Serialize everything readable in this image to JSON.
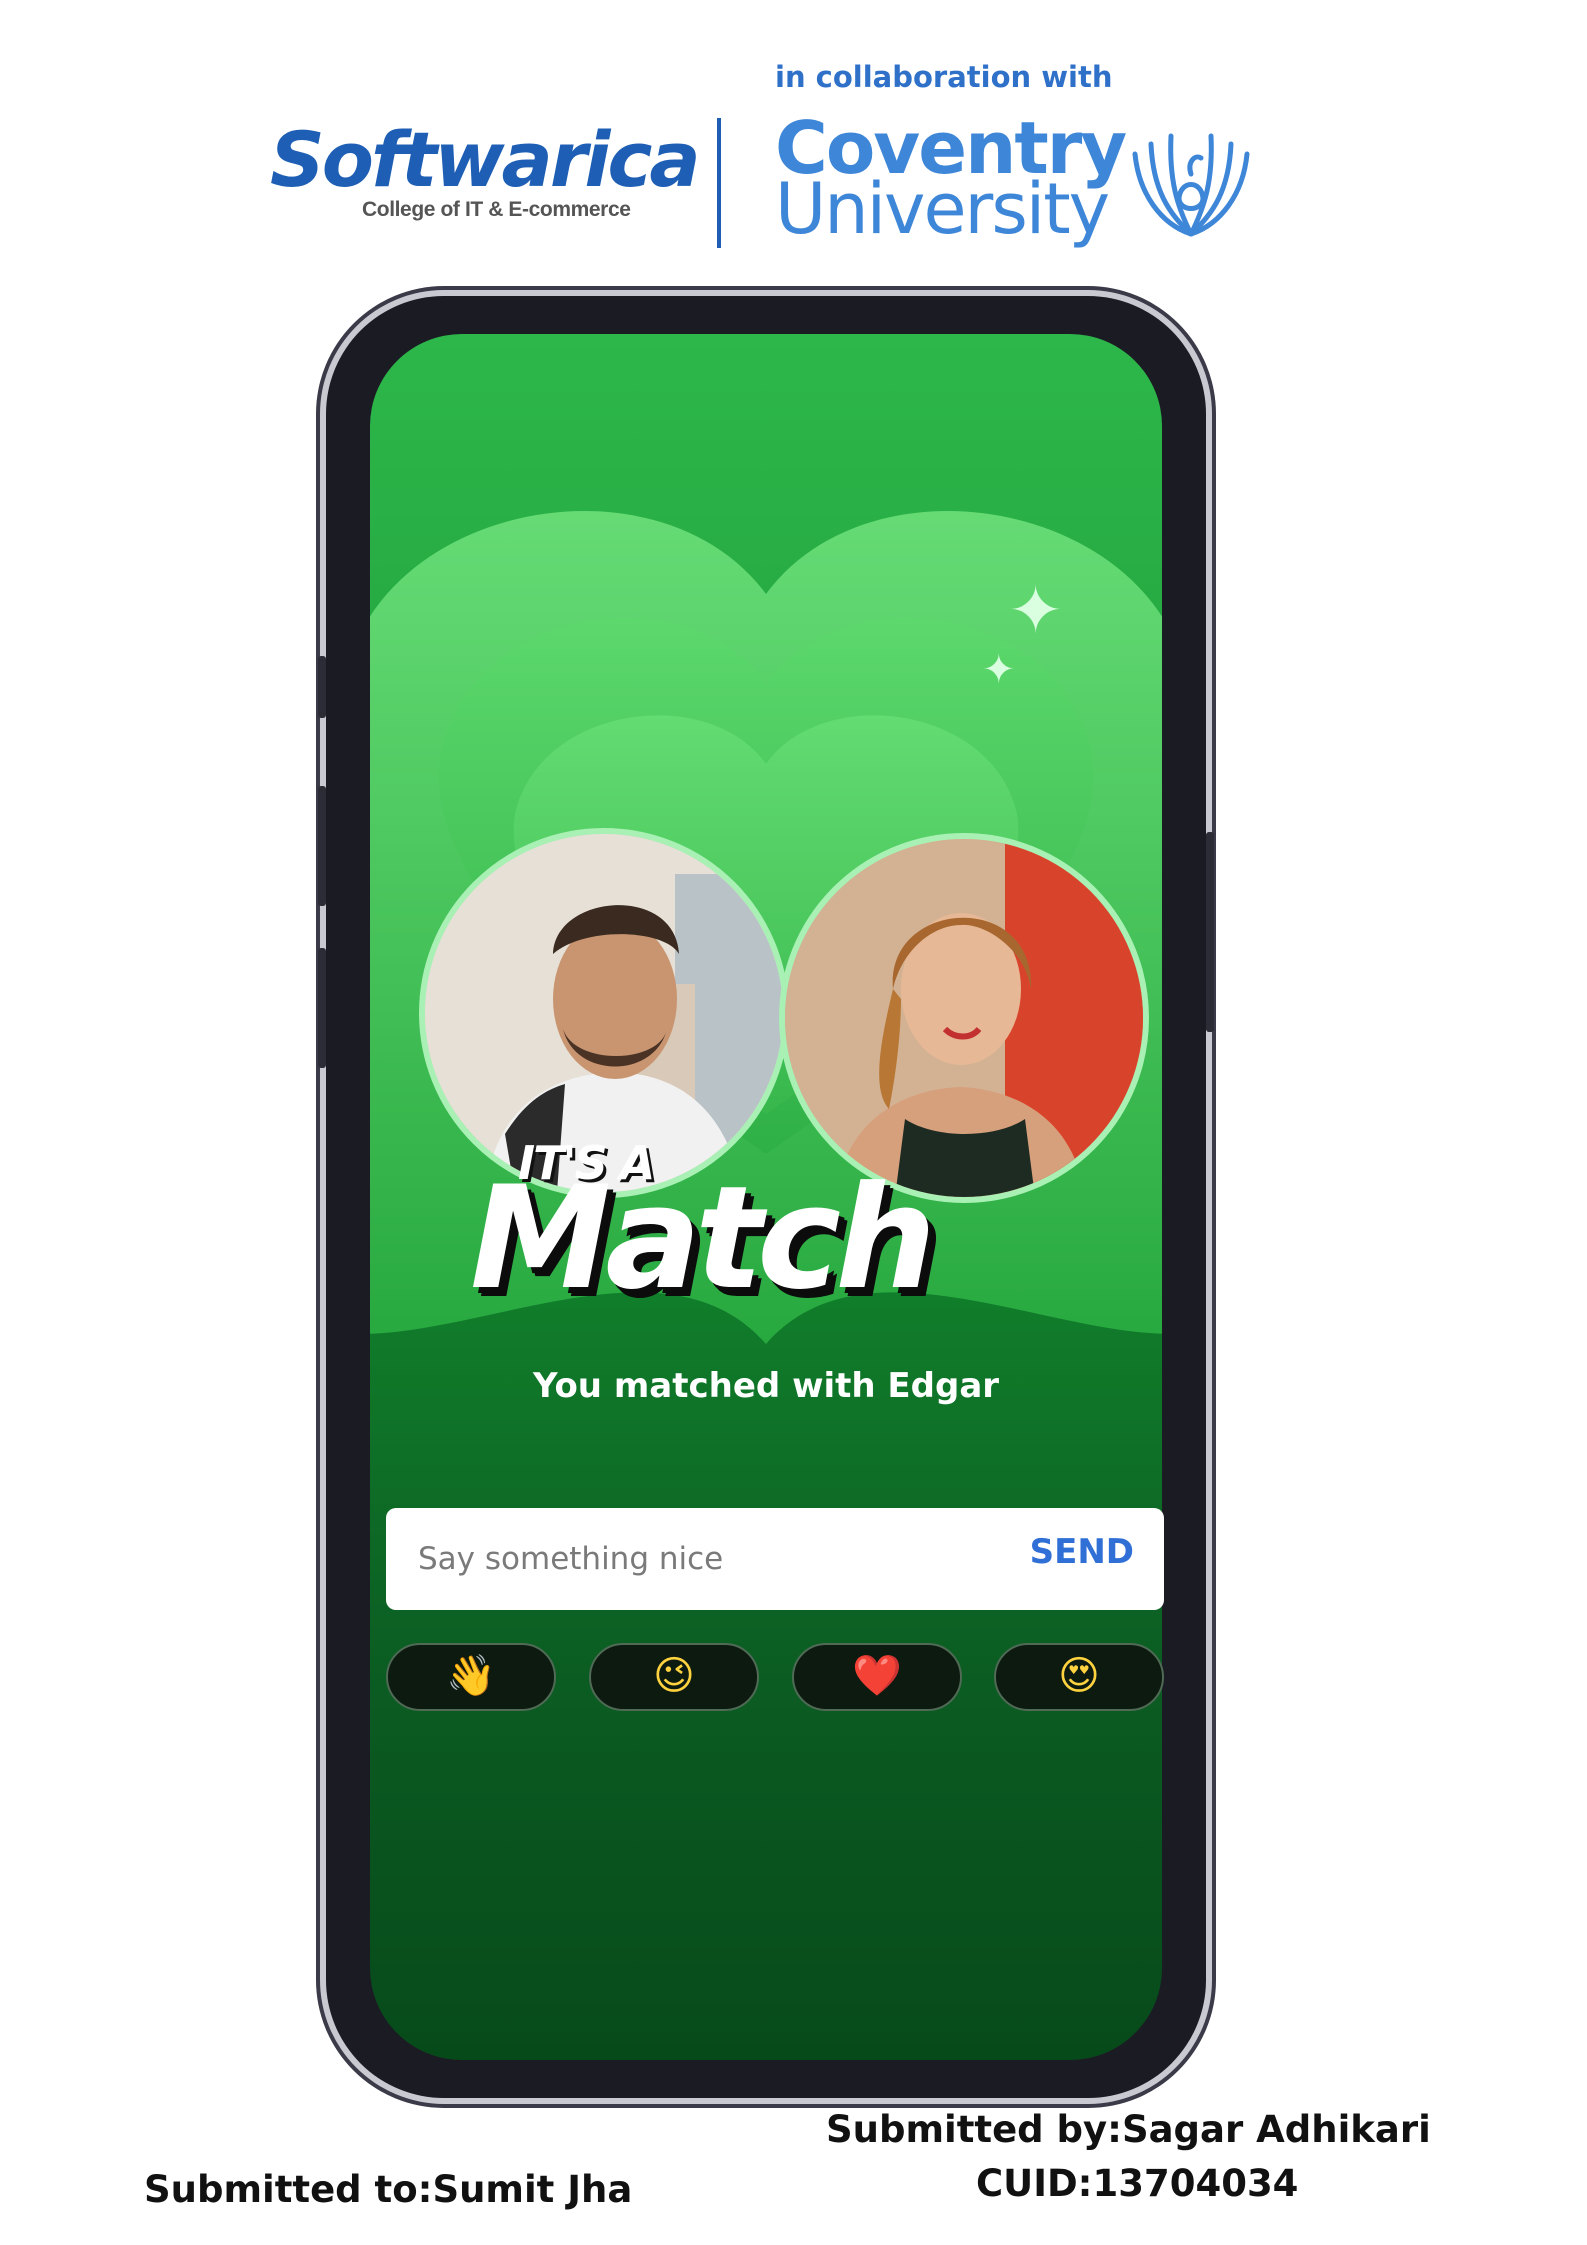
{
  "header": {
    "softwarica_name": "Softwarica",
    "softwarica_tagline": "College of IT & E-commerce",
    "collab_text": "in collaboration with",
    "coventry_line1": "Coventry",
    "coventry_line2": "University"
  },
  "match_screen": {
    "its_a": "IT'S A",
    "title": "Match",
    "subtitle": "You matched with Edgar",
    "message_placeholder": "Say something nice",
    "message_value": "",
    "send_label": "SEND",
    "quick_replies": [
      "👋",
      "😉",
      "❤️",
      "😍"
    ],
    "accent_color": "#2f6fd6",
    "background_top": "#2db74a",
    "background_bottom": "#074a1a"
  },
  "footer": {
    "submitted_by": "Submitted by:Sagar Adhikari",
    "cuid": "CUID:13704034",
    "submitted_to": "Submitted to:Sumit Jha"
  }
}
